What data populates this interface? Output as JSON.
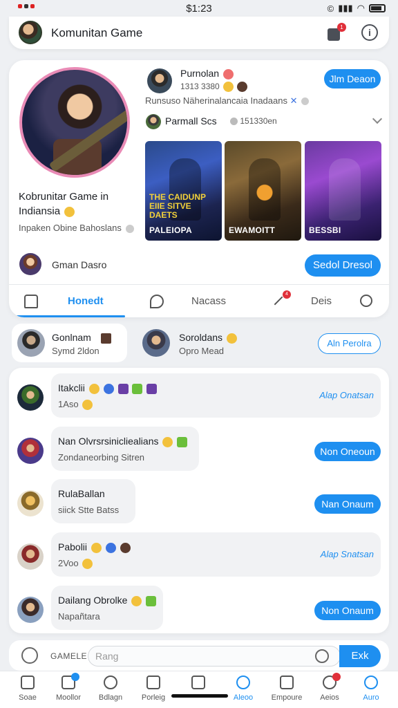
{
  "status_bar": {
    "time": "$1:23",
    "right_glyph": "©"
  },
  "header": {
    "title": "Komunitan Game",
    "notification_count": "1",
    "icons": {
      "avatar": "avatar",
      "badge": "puzzle-icon",
      "info": "info-icon"
    }
  },
  "profile": {
    "community_name": "Kobrunitar Game in Indiansia",
    "community_sub": "Inpaken Obine Bahoslans",
    "member_label": "Gman Dasro",
    "follow_label": "Sedol Dresol"
  },
  "user_post": {
    "name": "Purnolan",
    "stats": "1313 3380",
    "join_label": "Jlm Deaon",
    "description": "Runsuso Näherinalancaia Inadaans",
    "post_name": "Parmall Scs",
    "post_stats": "151330en"
  },
  "game_tiles": [
    {
      "headline": "THE CAIDUNP EIIE SITVE DAETS",
      "caption": "PALEIOPA"
    },
    {
      "headline": "",
      "caption": "EWAMOITT"
    },
    {
      "headline": "",
      "caption": "BESSBI"
    }
  ],
  "tabs": [
    {
      "label": "Honedt",
      "active": true
    },
    {
      "label": "Nacass",
      "active": false
    },
    {
      "label": "Deis",
      "active": false
    }
  ],
  "tab_badge": "4",
  "people": [
    {
      "name": "Gonlnam",
      "sub": "Symd 2ldon"
    },
    {
      "name": "Soroldans",
      "sub": "Opro Mead"
    }
  ],
  "people_action": "Aln Perolra",
  "feed": [
    {
      "title": "Itakclii",
      "sub": "1Aso",
      "action": "Alap Onatsan",
      "action_type": "link"
    },
    {
      "title": "Nan Olvrsrsinicliealians",
      "sub": "Zondaneorbing Sitren",
      "action": "Non Oneoun",
      "action_type": "button"
    },
    {
      "title": "RulaBallan",
      "sub": "siick Stte Batss",
      "action": "Nan Onaum",
      "action_type": "button"
    },
    {
      "title": "Pabolii",
      "sub": "2Voo",
      "action": "Alap Snatsan",
      "action_type": "link"
    },
    {
      "title": "Dailang Obrolke",
      "sub": "Napañtara",
      "action": "Non Onaum",
      "action_type": "button"
    }
  ],
  "composer": {
    "label": "GAMELE",
    "placeholder": "Rang",
    "send_label": "Exk"
  },
  "bottom_nav": [
    {
      "label": "Soae",
      "icon": "home-icon",
      "active": false
    },
    {
      "label": "Moollor",
      "icon": "phone-icon",
      "active": false
    },
    {
      "label": "Bdlagn",
      "icon": "chat-icon",
      "active": false
    },
    {
      "label": "Porleig",
      "icon": "list-icon",
      "active": false
    },
    {
      "label": "",
      "icon": "image-icon",
      "active": false
    },
    {
      "label": "Aleoo",
      "icon": "search-icon",
      "active": true
    },
    {
      "label": "Empoure",
      "icon": "gallery-icon",
      "active": false
    },
    {
      "label": "Aeios",
      "icon": "user-icon",
      "active": false
    },
    {
      "label": "Auro",
      "icon": "profile-icon",
      "active": true
    }
  ],
  "colors": {
    "accent": "#1e8ff0",
    "badge": "#e0303a",
    "background": "#eef0f3"
  }
}
